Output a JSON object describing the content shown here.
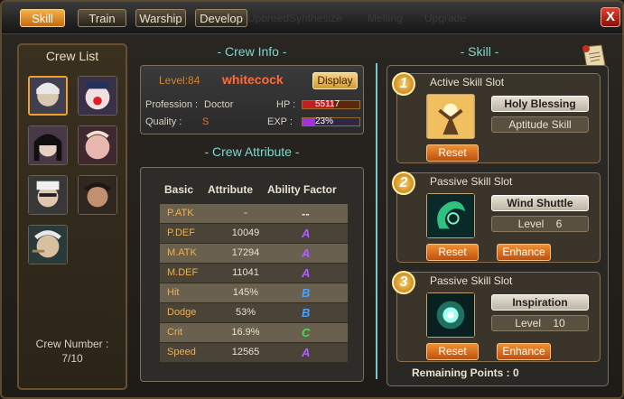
{
  "tabs": [
    "Skill",
    "Train",
    "Warship",
    "Develop"
  ],
  "ghost_tabs": [
    "Upbreed",
    "Synthesize",
    "Melting",
    "Upgrade"
  ],
  "close_label": "X",
  "crew_list": {
    "title": "Crew List",
    "number_label": "Crew Number :",
    "number_value": "7/10"
  },
  "crew_info": {
    "title": "- Crew Info -",
    "level": "Level:84",
    "name": "whitecock",
    "display_button": "Display",
    "profession_label": "Profession :",
    "profession": "Doctor",
    "hp_label": "HP :",
    "hp_value": "55117",
    "hp_fill": 0.55,
    "quality_label": "Quality :",
    "quality": "S",
    "exp_label": "EXP :",
    "exp_value": "23%",
    "exp_fill": 0.23
  },
  "crew_attribute": {
    "title": "- Crew Attribute -",
    "headers": [
      "Basic",
      "Attribute",
      "Ability Factor"
    ],
    "rows": [
      {
        "name": "P.ATK",
        "value": "-",
        "factor": "--",
        "color": "#e8e2d0"
      },
      {
        "name": "P.DEF",
        "value": "10049",
        "factor": "A",
        "color": "#b060ff"
      },
      {
        "name": "M.ATK",
        "value": "17294",
        "factor": "A",
        "color": "#b060ff"
      },
      {
        "name": "M.DEF",
        "value": "11041",
        "factor": "A",
        "color": "#b060ff"
      },
      {
        "name": "Hit",
        "value": "145%",
        "factor": "B",
        "color": "#4aa0ff"
      },
      {
        "name": "Dodge",
        "value": "53%",
        "factor": "B",
        "color": "#4aa0ff"
      },
      {
        "name": "Crit",
        "value": "16.9%",
        "factor": "C",
        "color": "#40e050"
      },
      {
        "name": "Speed",
        "value": "12565",
        "factor": "A",
        "color": "#b060ff"
      }
    ]
  },
  "skill": {
    "title": "- Skill -",
    "slots": [
      {
        "num": "1",
        "title": "Active Skill Slot",
        "name": "Holy Blessing",
        "sub": "Aptitude Skill",
        "reset": "Reset",
        "enhance": ""
      },
      {
        "num": "2",
        "title": "Passive Skill Slot",
        "name": "Wind Shuttle",
        "sub_label": "Level",
        "sub_value": "6",
        "reset": "Reset",
        "enhance": "Enhance"
      },
      {
        "num": "3",
        "title": "Passive Skill Slot",
        "name": "Inspiration",
        "sub_label": "Level",
        "sub_value": "10",
        "reset": "Reset",
        "enhance": "Enhance"
      }
    ],
    "remaining": "Remaining Points : 0"
  },
  "colors": {
    "accent": "#f0a030",
    "title": "#7cd7cf",
    "name": "#ff6a3a"
  }
}
